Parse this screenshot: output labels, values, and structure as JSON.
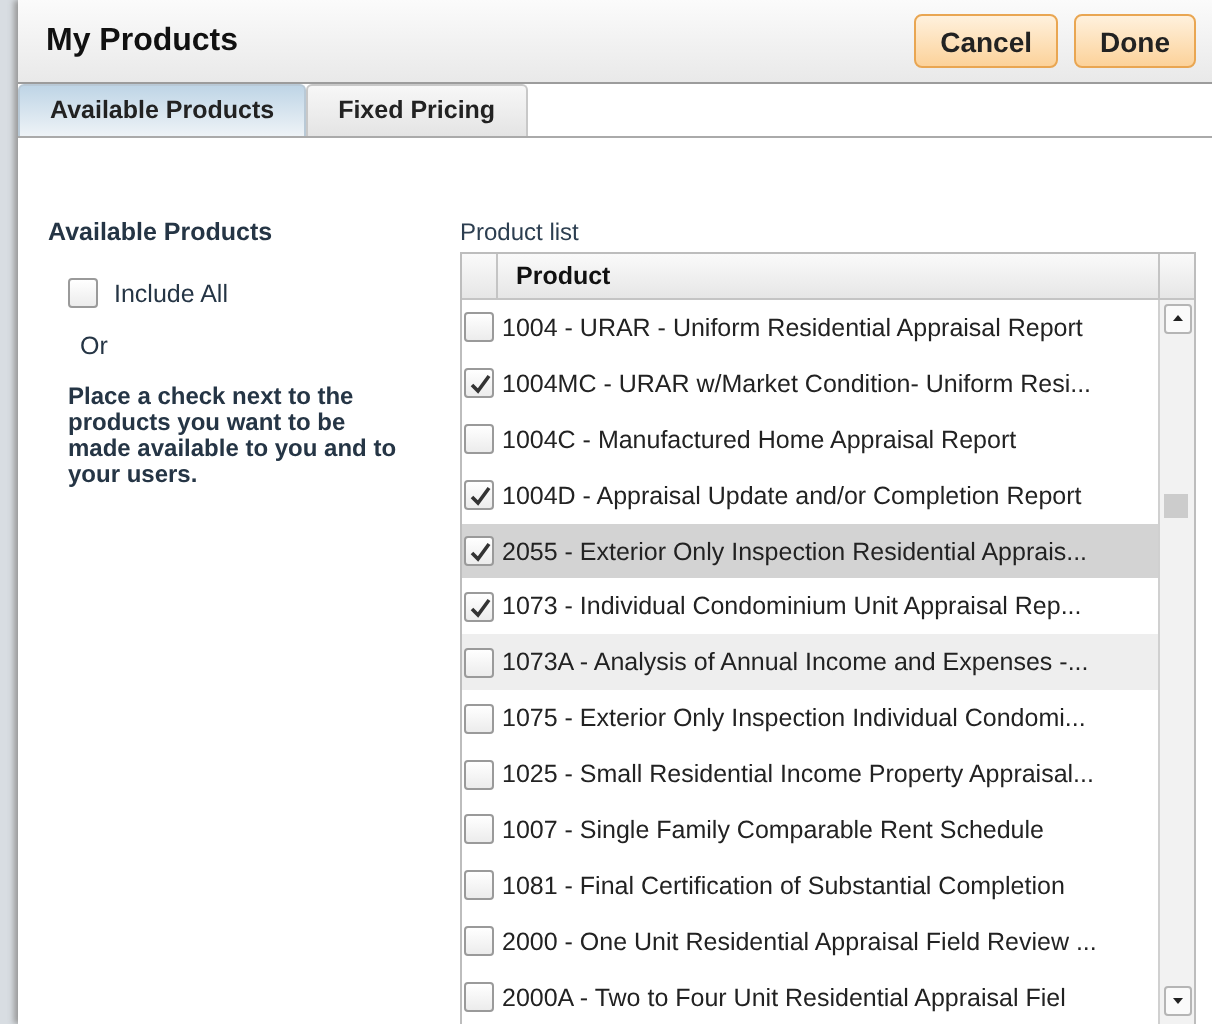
{
  "window": {
    "title": "My Products",
    "buttons": [
      {
        "label": "Cancel"
      },
      {
        "label": "Done"
      }
    ]
  },
  "tabs": [
    {
      "label": "Available Products",
      "selected": true
    },
    {
      "label": "Fixed Pricing",
      "selected": false
    }
  ],
  "side": {
    "heading": "Available Products",
    "include_all": {
      "label": "Include All",
      "checked": false
    },
    "or": "Or",
    "instructions": "Place a check next to the products you want to be made available to you and to your users."
  },
  "product_list": {
    "label": "Product list",
    "column": "Product",
    "rows": [
      {
        "text": "1004 - URAR - Uniform Residential Appraisal Report",
        "checked": false,
        "selected": false,
        "hovered": false
      },
      {
        "text": "1004MC - URAR w/Market Condition- Uniform Resi...",
        "checked": true,
        "selected": false,
        "hovered": false
      },
      {
        "text": "1004C - Manufactured Home Appraisal Report",
        "checked": false,
        "selected": false,
        "hovered": false
      },
      {
        "text": "1004D - Appraisal Update and/or Completion Report",
        "checked": true,
        "selected": false,
        "hovered": false
      },
      {
        "text": "2055 - Exterior Only Inspection Residential Apprais...",
        "checked": true,
        "selected": true,
        "hovered": false
      },
      {
        "text": "1073 - Individual Condominium Unit Appraisal Rep...",
        "checked": true,
        "selected": false,
        "hovered": false
      },
      {
        "text": "1073A - Analysis of Annual Income and Expenses -...",
        "checked": false,
        "selected": false,
        "hovered": true
      },
      {
        "text": "1075 - Exterior Only Inspection Individual Condomi...",
        "checked": false,
        "selected": false,
        "hovered": false
      },
      {
        "text": "1025 - Small Residential Income Property Appraisal...",
        "checked": false,
        "selected": false,
        "hovered": false
      },
      {
        "text": "1007 - Single Family Comparable Rent Schedule",
        "checked": false,
        "selected": false,
        "hovered": false
      },
      {
        "text": "1081 - Final Certification of Substantial Completion",
        "checked": false,
        "selected": false,
        "hovered": false
      },
      {
        "text": "2000 - One Unit Residential Appraisal Field Review ...",
        "checked": false,
        "selected": false,
        "hovered": false
      },
      {
        "text": "2000A - Two to Four Unit Residential Appraisal Fiel",
        "checked": false,
        "selected": false,
        "hovered": false
      }
    ]
  }
}
